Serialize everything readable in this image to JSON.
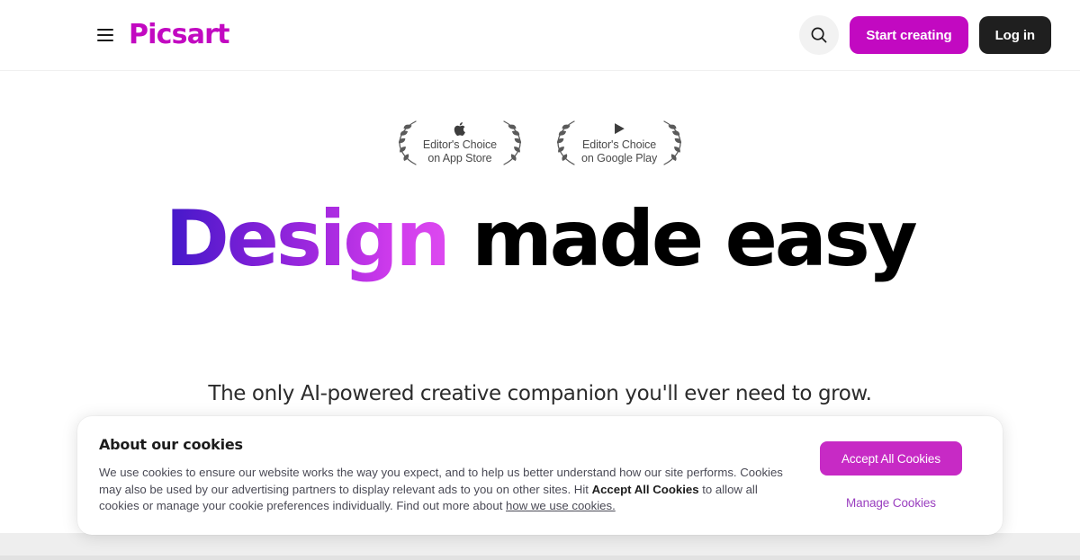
{
  "header": {
    "menu_icon": "hamburger-menu-icon",
    "logo_text": "Picsart",
    "search_icon": "search-icon",
    "start_creating_label": "Start creating",
    "login_label": "Log in",
    "brand_color": "#C209C1",
    "login_bg_color": "#1f1f1f"
  },
  "hero": {
    "awards": [
      {
        "icon": "apple-logo-icon",
        "line1": "Editor's Choice",
        "line2": "on App Store"
      },
      {
        "icon": "google-play-icon",
        "line1": "Editor's Choice",
        "line2": "on Google Play"
      }
    ],
    "headline_gradient_part": "Design",
    "headline_plain_part": " made easy",
    "headline_gradient_from": "#4219C9",
    "headline_gradient_to": "#DD49F0",
    "subtitle": "The only AI-powered creative companion you'll ever need to grow."
  },
  "cookie_banner": {
    "title": "About our cookies",
    "body_part1": "We use cookies to ensure our website works the way you expect, and to help us better understand how our site performs. Cookies may also be used by our advertising partners to display relevant ads to you on other sites. Hit ",
    "body_bold": "Accept All Cookies",
    "body_part2": " to allow all cookies or manage your cookie preferences individually. Find out more about ",
    "link_label": "how we use cookies.",
    "accept_label": "Accept All Cookies",
    "manage_label": "Manage Cookies",
    "accept_color": "#C72AC5",
    "manage_color": "#9A3FBF"
  }
}
